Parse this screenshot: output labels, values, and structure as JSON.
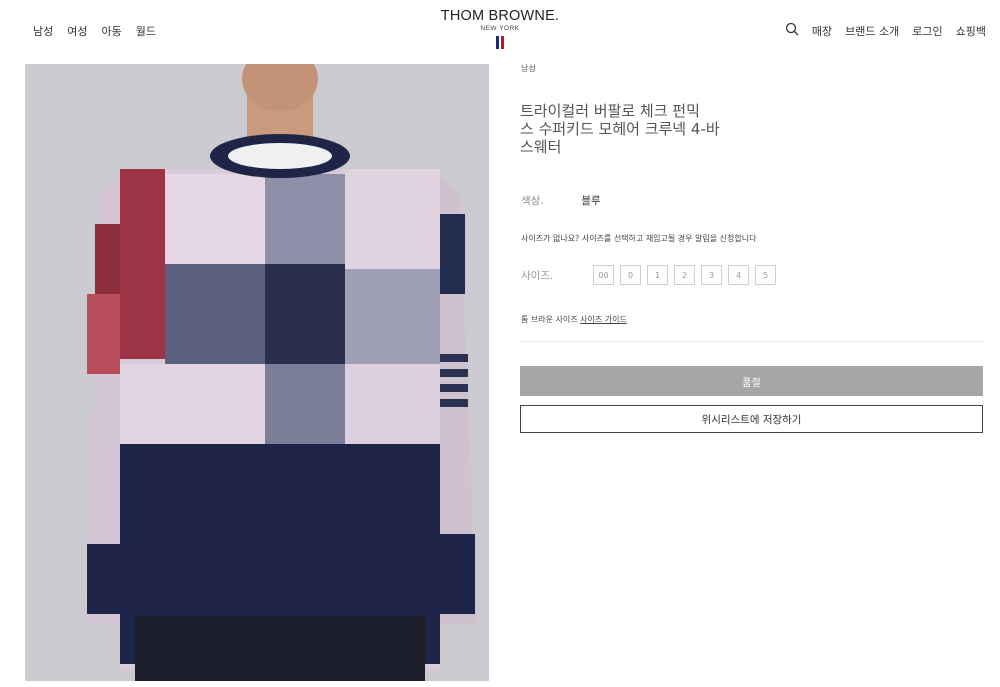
{
  "nav_left": [
    "남성",
    "여성",
    "아동",
    "월드"
  ],
  "logo": {
    "main": "THOM BROWNE.",
    "sub": "NEW YORK",
    "flag_colors": [
      "#1f2a6b",
      "#c8102e"
    ]
  },
  "nav_right": {
    "search_icon": "search-icon",
    "items": [
      "매장",
      "브랜드 소개",
      "로그인",
      "쇼핑백"
    ]
  },
  "product": {
    "breadcrumb": "남성",
    "title": "트라이컬러 버팔로 체크 펀믹\n스 수퍼키드 모헤어 크루넥 4-바\n스웨터",
    "color_label": "색상.",
    "color_value": "블루",
    "size_notice": "사이즈가 없나요? 사이즈를 선택하고 재입고될 경우 알림을 신청합니다",
    "size_label": "사이즈.",
    "sizes": [
      "00",
      "0",
      "1",
      "2",
      "3",
      "4",
      "5"
    ],
    "guide_prefix": "톰 브라운 사이즈",
    "guide_link": "사이즈 가이드",
    "soldout_label": "품절",
    "wishlist_label": "위시리스트에 저장하기"
  },
  "colors": {
    "sweater_navy": "#1c2445",
    "sweater_red": "#b04450",
    "sweater_pink": "#ddd0dc",
    "background": "#cacad0"
  }
}
